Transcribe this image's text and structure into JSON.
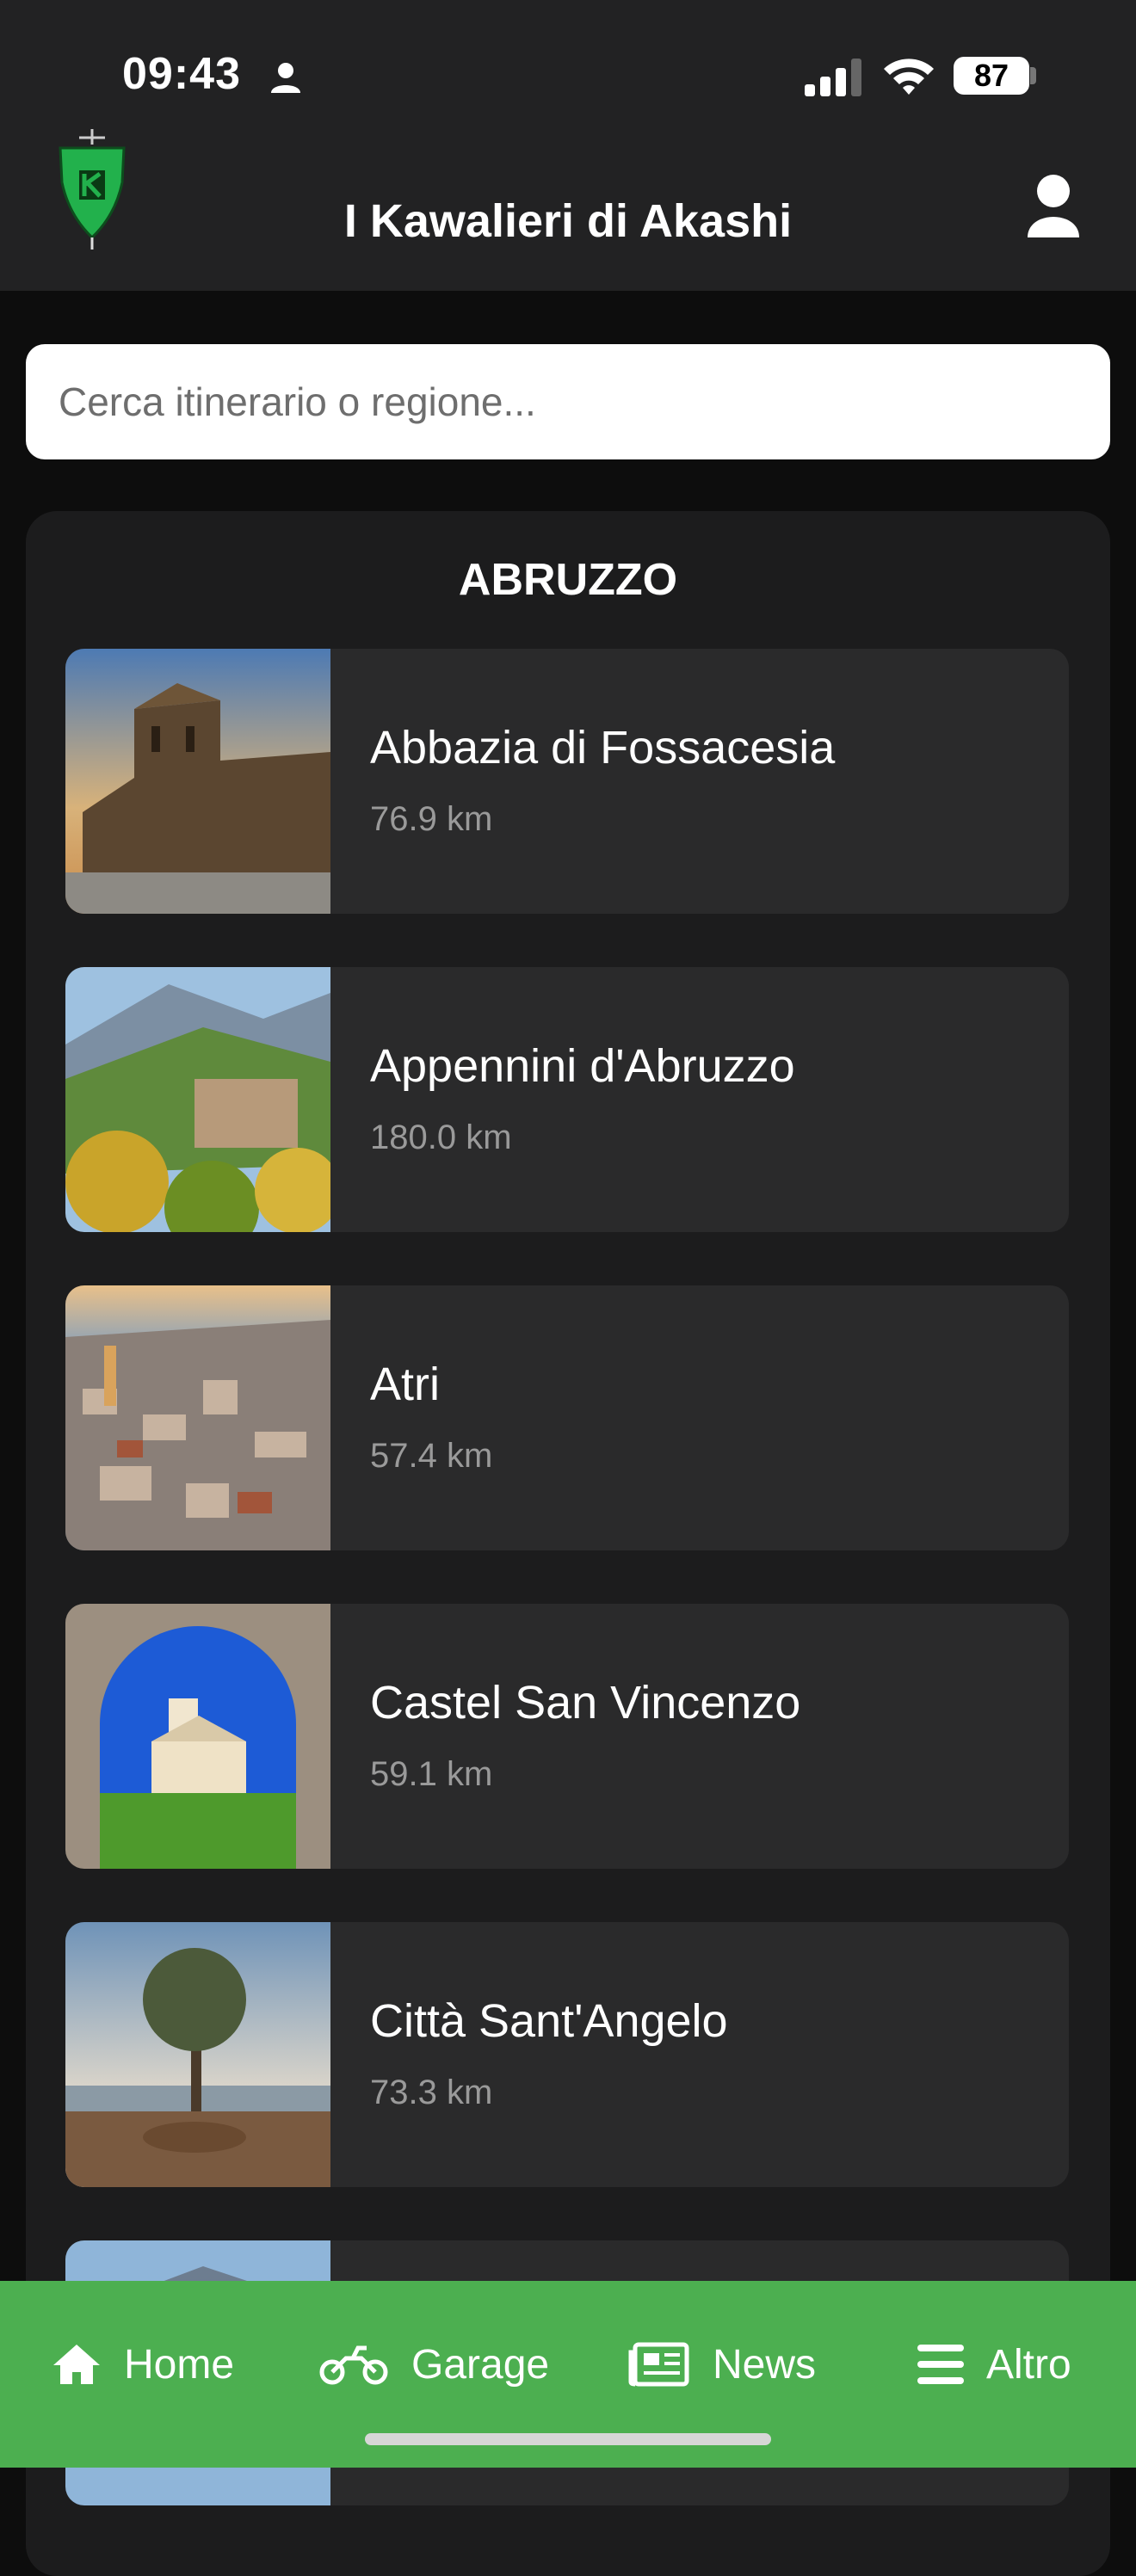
{
  "status_bar": {
    "time": "09:43",
    "battery": "87"
  },
  "header": {
    "title": "I Kawalieri di Akashi"
  },
  "search": {
    "placeholder": "Cerca itinerario o regione..."
  },
  "region": {
    "name": "ABRUZZO",
    "itineraries": [
      {
        "name": "Abbazia di Fossacesia",
        "distance": "76.9 km"
      },
      {
        "name": "Appennini d'Abruzzo",
        "distance": "180.0 km"
      },
      {
        "name": "Atri",
        "distance": "57.4 km"
      },
      {
        "name": "Castel San Vincenzo",
        "distance": "59.1 km"
      },
      {
        "name": "Città Sant'Angelo",
        "distance": "73.3 km"
      }
    ]
  },
  "nav": {
    "home": "Home",
    "garage": "Garage",
    "news": "News",
    "more": "Altro"
  },
  "colors": {
    "accent": "#4caf50",
    "header_bg": "#222223",
    "card_bg": "#2a2a2b"
  }
}
